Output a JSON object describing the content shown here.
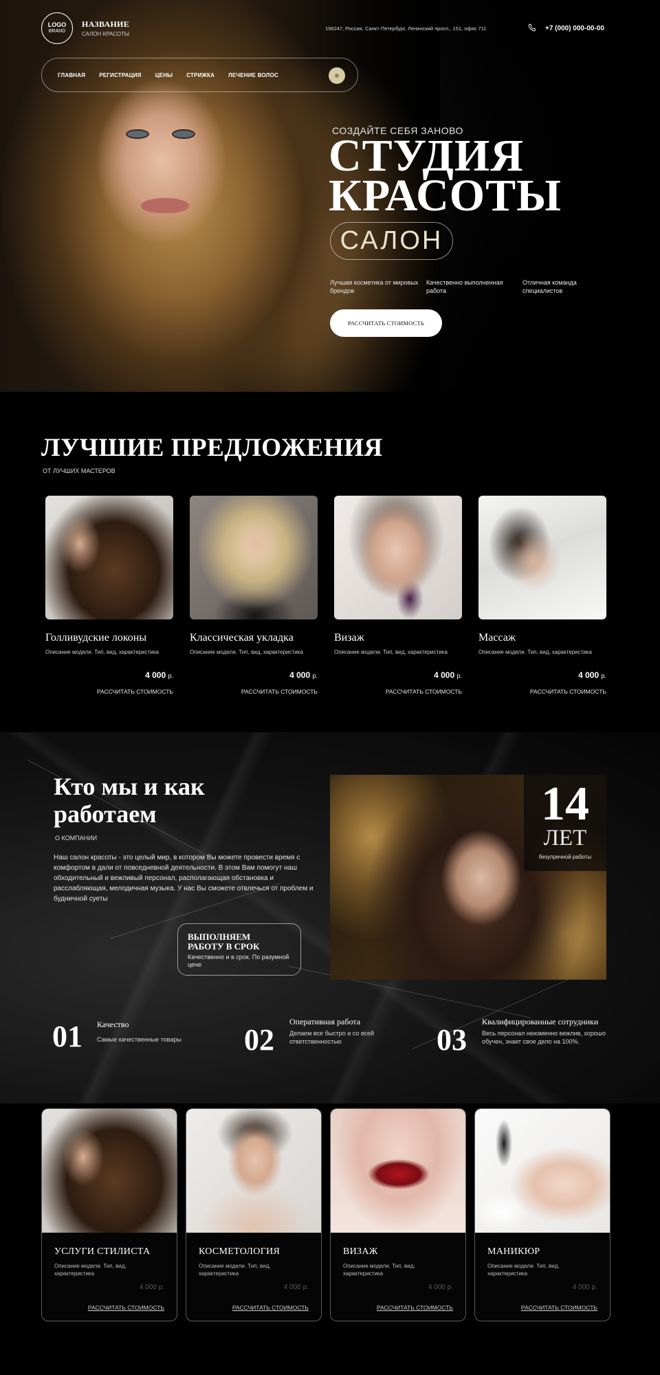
{
  "colors": {
    "background": "#000000",
    "accent_gold": "#d7cba6",
    "text": "#ffffff"
  },
  "header": {
    "logo": {
      "line1": "LOGO",
      "line2": "BRAND"
    },
    "brand_name": "НАЗВАНИЕ",
    "brand_sub": "САЛОН КРАСОТЫ",
    "address": "196247, Россия, Санкт-Петербург, Ленинский просп., 151, офис 711",
    "phone_icon": "phone-icon",
    "phone": "+7 (000) 000-00-00"
  },
  "nav": {
    "items": [
      {
        "label": "ГЛАВНАЯ"
      },
      {
        "label": "РЕГИСТРАЦИЯ"
      },
      {
        "label": "ЦЕНЫ"
      },
      {
        "label": "СТРИЖКА"
      },
      {
        "label": "ЛЕЧЕНИЕ ВОЛОС"
      }
    ]
  },
  "hero": {
    "kicker": "СОЗДАЙТЕ СЕБЯ ЗАНОВО",
    "title_line1": "СТУДИЯ",
    "title_line2": "КРАСОТЫ",
    "pill": "САЛОН",
    "features": [
      {
        "text": "Лучшая косметика от мировых брендов"
      },
      {
        "text": "Качественно выполненная работа"
      },
      {
        "text": "Отличная команда специалистов"
      }
    ],
    "cta": "РАССЧИТАТЬ СТОИМОСТЬ"
  },
  "offers": {
    "title": "ЛУЧШИЕ ПРЕДЛОЖЕНИЯ",
    "subtitle": "ОТ ЛУЧШИХ МАСТЕРОВ",
    "items": [
      {
        "name": "Голливудские локоны",
        "desc": "Описание модели. Тип, вид, характеристика",
        "price": "4 000",
        "currency": "р.",
        "link": "РАССЧИТАТЬ СТОИМОСТЬ"
      },
      {
        "name": "Классическая укладка",
        "desc": "Описание модели. Тип, вид, характеристика",
        "price": "4 000",
        "currency": "р.",
        "link": "РАССЧИТАТЬ СТОИМОСТЬ"
      },
      {
        "name": "Визаж",
        "desc": "Описание модели. Тип, вид, характеристика",
        "price": "4 000",
        "currency": "р.",
        "link": "РАССЧИТАТЬ СТОИМОСТЬ"
      },
      {
        "name": "Массаж",
        "desc": "Описание модели. Тип, вид, характеристика",
        "price": "4 000",
        "currency": "р.",
        "link": "РАССЧИТАТЬ СТОИМОСТЬ"
      }
    ]
  },
  "about": {
    "title_line1": "Кто мы и как",
    "title_line2": "работаем",
    "subtitle": "О КОМПАНИИ",
    "text": "Наш салон красоты - это целый мир, в котором Вы можете провести время с комфортом в дали от повседневной деятельности. В этом Вам помогут наш обходительный и вежливый персонал, располагающая обстановка и расслабляющая, мелодичная музыка. У нас Вы сможете отвлечься от проблем и будничной суеты",
    "box_title_line1": "ВЫПОЛНЯЕМ",
    "box_title_line2": "РАБОТУ В СРОК",
    "box_text": "Качественно и в срок. По разумной цене",
    "years_num": "14",
    "years_word": "ЛЕТ",
    "years_sub": "безупречной работы"
  },
  "stats": [
    {
      "num": "01",
      "title": "Качество",
      "desc": "Самые качественные товары"
    },
    {
      "num": "02",
      "title": "Оперативная работа",
      "desc": "Делаем все быстро и со всей ответственностью"
    },
    {
      "num": "03",
      "title": "Квалифицированные сотрудники",
      "desc": "Весь персонал неизменно вежлив, хорошо обучен, знает свое дело на 100%."
    }
  ],
  "services": [
    {
      "name": "УСЛУГИ СТИЛИСТА",
      "desc": "Описание модели. Тип, вид, характеристика",
      "price": "4 000 р.",
      "link": "РАССЧИТАТЬ СТОИМОСТЬ"
    },
    {
      "name": "КОСМЕТОЛОГИЯ",
      "desc": "Описание модели. Тип, вид, характеристика",
      "price": "4 000 р.",
      "link": "РАССЧИТАТЬ СТОИМОСТЬ"
    },
    {
      "name": "ВИЗАЖ",
      "desc": "Описание модели. Тип, вид, характеристика",
      "price": "4 000 р.",
      "link": "РАССЧИТАТЬ СТОИМОСТЬ"
    },
    {
      "name": "МАНИКЮР",
      "desc": "Описание модели. Тип, вид, характеристика",
      "price": "4 000 р.",
      "link": "РАССЧИТАТЬ СТОИМОСТЬ"
    }
  ]
}
